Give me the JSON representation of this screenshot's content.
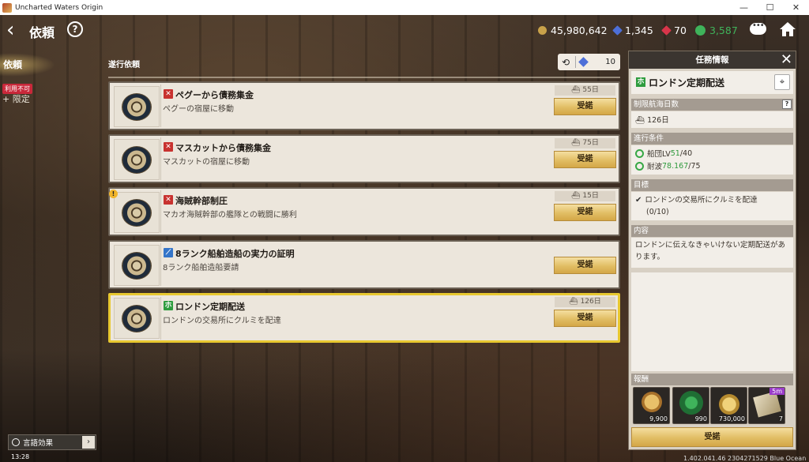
{
  "window": {
    "title": "Uncharted Waters Origin",
    "minimize": "—",
    "maximize": "☐",
    "close": "✕"
  },
  "header": {
    "title": "依頼",
    "help": "?",
    "currencies": [
      {
        "name": "gold",
        "value": "45,980,642",
        "color": "#c9a24a"
      },
      {
        "name": "sapphire",
        "value": "1,345",
        "color": "#4d6fd8"
      },
      {
        "name": "ruby",
        "value": "70",
        "color": "#d8354a"
      },
      {
        "name": "emblem",
        "value": "3,587",
        "color": "#3fb35b"
      }
    ]
  },
  "side": {
    "tab_label": "依頼",
    "badge": "利用不可",
    "limit_label": "+ 限定"
  },
  "list": {
    "header": "遂行依頼",
    "counter": "10",
    "quests": [
      {
        "category": "red",
        "icon": "✕",
        "title": "ペグーから債務集金",
        "desc": "ペグーの宿屋に移動",
        "days": "55日",
        "accept": "受諾"
      },
      {
        "category": "red",
        "icon": "✕",
        "title": "マスカットから債務集金",
        "desc": "マスカットの宿屋に移動",
        "days": "75日",
        "accept": "受諾"
      },
      {
        "category": "red",
        "icon": "✕",
        "title": "海賊幹部制圧",
        "desc": "マカオ海賊幹部の艦隊との戦闘に勝利",
        "days": "15日",
        "accept": "受諾"
      },
      {
        "category": "blue",
        "icon": "⟋",
        "title": "8ランク船舶造船の実力の証明",
        "desc": "8ランク船舶造船要請",
        "days": "",
        "accept": "受諾"
      },
      {
        "category": "green",
        "icon": "ホ",
        "title": "ロンドン定期配送",
        "desc": "ロンドンの交易所にクルミを配達",
        "days": "126日",
        "accept": "受諾"
      }
    ]
  },
  "panel": {
    "title": "任務情報",
    "quest_title": "ロンドン定期配送",
    "limit_head": "制限航海日数",
    "limit_days": "126日",
    "cond_head": "進行条件",
    "conditions": [
      {
        "label": "船団LV ",
        "value": "51",
        "req": "/40"
      },
      {
        "label": "耐波 ",
        "value": "78.167",
        "req": "/75"
      }
    ],
    "goal_head": "目標",
    "goal_text": "ロンドンの交易所にクルミを配達",
    "goal_progress": "(0/10)",
    "content_head": "内容",
    "content_text": "ロンドンに伝えなきゃいけない定期配送があります。",
    "reward_head": "報酬",
    "rewards": [
      {
        "icon": "medal-icon",
        "num": "9,900"
      },
      {
        "icon": "laurel-icon",
        "num": "990"
      },
      {
        "icon": "coin-icon",
        "num": "730,000"
      },
      {
        "icon": "scroll-icon",
        "num": "7",
        "badge": "5m"
      }
    ],
    "accept": "受諾"
  },
  "footer": {
    "lang": "言語効果",
    "clock": "13:28",
    "version": "1.402.041.46 2304271529 Blue Ocean"
  }
}
